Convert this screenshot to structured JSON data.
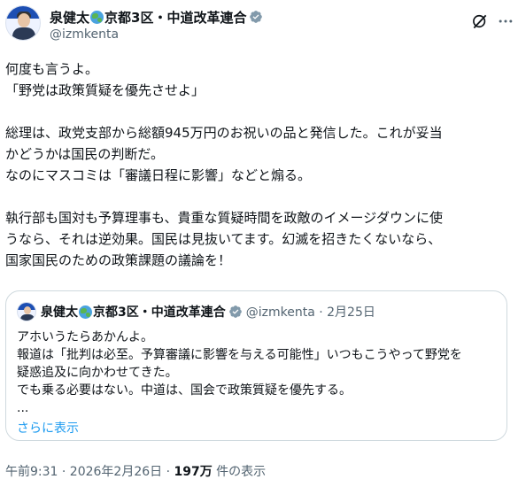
{
  "author": {
    "name": "泉健太",
    "name_suffix": "京都3区・中道改革連合",
    "handle": "@izmkenta",
    "avatar_icon": "avatar"
  },
  "tweet": {
    "lines": [
      "何度も言うよ。",
      "「野党は政策質疑を優先させよ」",
      "",
      "総理は、政党支部から総額945万円のお祝いの品と発信した。これが妥当",
      "かどうかは国民の判断だ。",
      "なのにマスコミは「審議日程に影響」などと煽る。",
      "",
      "執行部も国対も予算理事も、貴重な質疑時間を政敵のイメージダウンに使",
      "うなら、それは逆効果。国民は見抜いてます。幻滅を招きたくないなら、",
      "国家国民のための政策課題の議論を！"
    ]
  },
  "quote": {
    "name": "泉健太",
    "name_suffix": "京都3区・中道改革連合",
    "handle_date": "@izmkenta · 2月25日",
    "lines": [
      "アホいうたらあかんよ。",
      "報道は「批判は必至。予算審議に影響を与える可能性」いつもこうやって野党を",
      "疑惑追及に向かわせてきた。",
      "でも乗る必要はない。中道は、国会で政策質疑を優先する。",
      "..."
    ],
    "show_more": "さらに表示"
  },
  "meta": {
    "time_date": "午前9:31 · 2026年2月26日 · ",
    "views_count": "197万",
    "views_label": " 件の表示"
  },
  "colors": {
    "verified": "#1d9bf0",
    "link": "#1d9bf0",
    "secondary_text": "#536471"
  }
}
